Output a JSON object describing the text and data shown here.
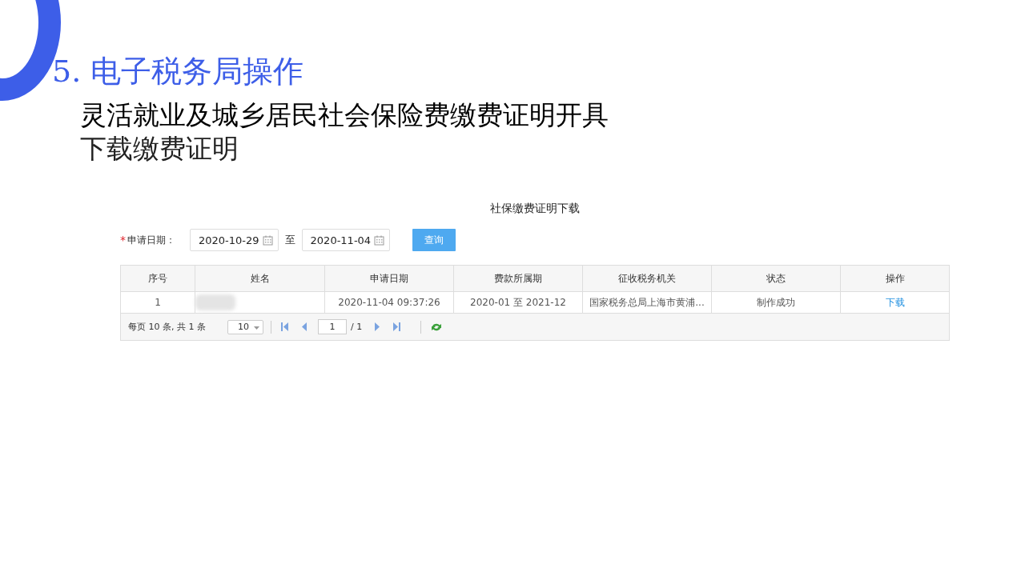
{
  "slide": {
    "title": "5. 电子税务局操作",
    "subtitle": "灵活就业及城乡居民社会保险费缴费证明开具",
    "step": "下载缴费证明"
  },
  "panel": {
    "title": "社保缴费证明下载",
    "form": {
      "required_mark": "*",
      "label": "申请日期：",
      "date_from": "2020-10-29",
      "separator": "至",
      "date_to": "2020-11-04",
      "button": "查询"
    },
    "table": {
      "columns": [
        "序号",
        "姓名",
        "申请日期",
        "费款所属期",
        "征收税务机关",
        "状态",
        "操作"
      ],
      "rows": [
        {
          "cells": [
            {
              "kind": "text",
              "text": "1"
            },
            {
              "kind": "blurred"
            },
            {
              "kind": "text",
              "text": "2020-11-04 09:37:26"
            },
            {
              "kind": "text",
              "text": "2020-01 至 2021-12"
            },
            {
              "kind": "text",
              "text": "国家税务总局上海市黄浦..."
            },
            {
              "kind": "text",
              "text": "制作成功"
            },
            {
              "kind": "link",
              "text": "下载"
            }
          ]
        }
      ]
    },
    "pager": {
      "summary": "每页 10 条, 共 1 条",
      "page_size": "10",
      "page": "1",
      "total": "/ 1"
    }
  }
}
